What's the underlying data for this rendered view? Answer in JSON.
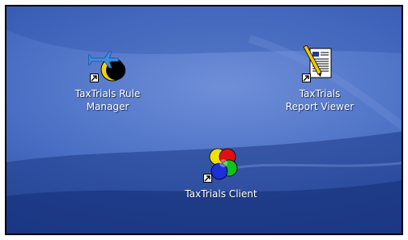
{
  "desktop": {
    "icons": [
      {
        "label_line1": "TaxTrials Rule",
        "label_line2": "Manager",
        "icon": "airplane-moon-icon"
      },
      {
        "label_line1": "TaxTrials",
        "label_line2": "Report Viewer",
        "icon": "document-pencil-icon"
      },
      {
        "label_line1": "TaxTrials Client",
        "icon": "colored-puzzle-icon"
      }
    ],
    "colors": {
      "background": "#3f63b8",
      "text": "#ffffff"
    }
  }
}
